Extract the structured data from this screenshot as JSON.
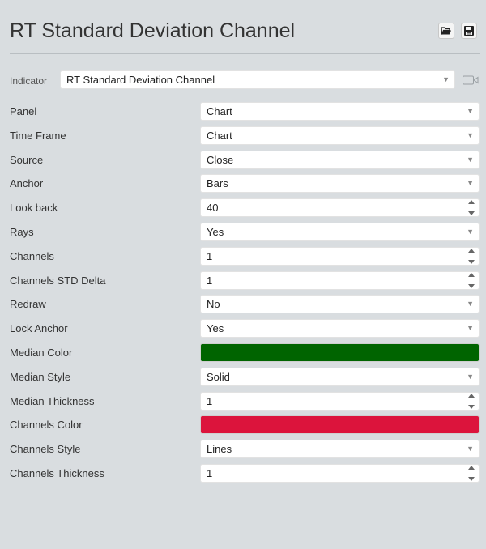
{
  "header": {
    "title": "RT Standard Deviation Channel"
  },
  "indicator": {
    "label": "Indicator",
    "value": "RT Standard Deviation Channel"
  },
  "fields": [
    {
      "label": "Panel",
      "value": "Chart",
      "kind": "select"
    },
    {
      "label": "Time Frame",
      "value": "Chart",
      "kind": "select"
    },
    {
      "label": "Source",
      "value": "Close",
      "kind": "select"
    },
    {
      "label": "Anchor",
      "value": "Bars",
      "kind": "select"
    },
    {
      "label": "Look back",
      "value": "40",
      "kind": "number"
    },
    {
      "label": "Rays",
      "value": "Yes",
      "kind": "select"
    },
    {
      "label": "Channels",
      "value": "1",
      "kind": "number"
    },
    {
      "label": "Channels STD Delta",
      "value": "1",
      "kind": "number"
    },
    {
      "label": "Redraw",
      "value": "No",
      "kind": "select"
    },
    {
      "label": "Lock Anchor",
      "value": "Yes",
      "kind": "select"
    },
    {
      "label": "Median Color",
      "value": "#006400",
      "kind": "color"
    },
    {
      "label": "Median Style",
      "value": "Solid",
      "kind": "select"
    },
    {
      "label": "Median Thickness",
      "value": "1",
      "kind": "number"
    },
    {
      "label": "Channels Color",
      "value": "#dc143c",
      "kind": "color"
    },
    {
      "label": "Channels Style",
      "value": "Lines",
      "kind": "select"
    },
    {
      "label": "Channels Thickness",
      "value": "1",
      "kind": "number"
    }
  ],
  "icons": {
    "open": "folder-open-icon",
    "save": "save-icon",
    "camera": "camera-icon",
    "dropdown": "chevron-down-icon",
    "spinner": "spinner-arrows-icon"
  }
}
